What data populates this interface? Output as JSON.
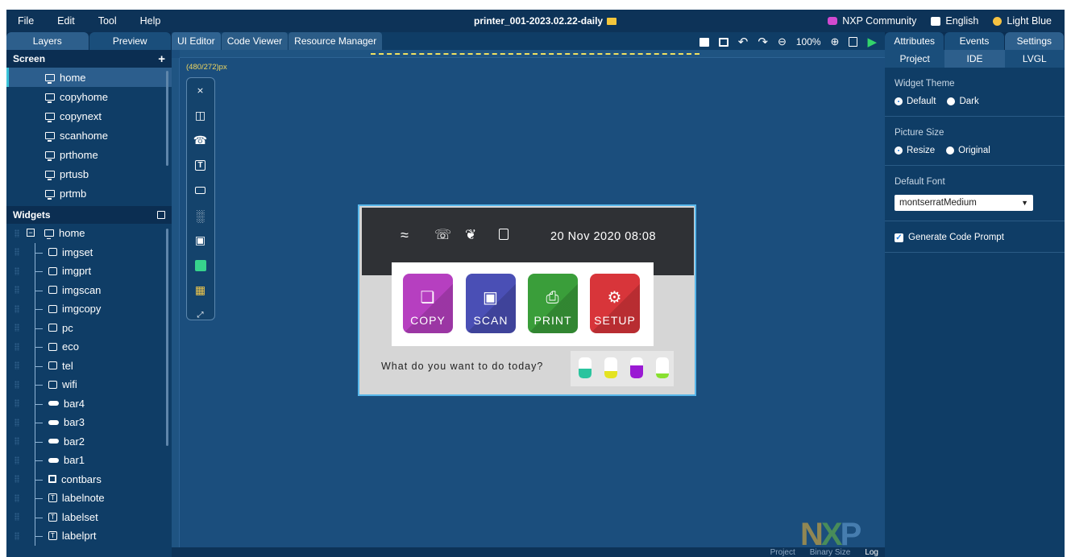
{
  "menubar": {
    "items": [
      "File",
      "Edit",
      "Tool",
      "Help"
    ],
    "title": "printer_001-2023.02.22-daily",
    "right": {
      "community": "NXP Community",
      "language": "English",
      "theme": "Light Blue"
    }
  },
  "left_panel": {
    "tabs": [
      "Layers",
      "Preview"
    ],
    "screen_header": "Screen",
    "screens": [
      "home",
      "copyhome",
      "copynext",
      "scanhome",
      "prthome",
      "prtusb",
      "prtmb"
    ],
    "widgets_header": "Widgets",
    "widgets": [
      {
        "label": "home",
        "icon": "monitor-icon"
      },
      {
        "label": "imgset",
        "icon": "image-icon"
      },
      {
        "label": "imgprt",
        "icon": "image-icon"
      },
      {
        "label": "imgscan",
        "icon": "image-icon"
      },
      {
        "label": "imgcopy",
        "icon": "image-icon"
      },
      {
        "label": "pc",
        "icon": "image-icon"
      },
      {
        "label": "eco",
        "icon": "image-icon"
      },
      {
        "label": "tel",
        "icon": "image-icon"
      },
      {
        "label": "wifi",
        "icon": "image-icon"
      },
      {
        "label": "bar4",
        "icon": "bar-icon"
      },
      {
        "label": "bar3",
        "icon": "bar-icon"
      },
      {
        "label": "bar2",
        "icon": "bar-icon"
      },
      {
        "label": "bar1",
        "icon": "bar-icon"
      },
      {
        "label": "contbars",
        "icon": "container-icon"
      },
      {
        "label": "labelnote",
        "icon": "text-icon"
      },
      {
        "label": "labelset",
        "icon": "text-icon"
      },
      {
        "label": "labelprt",
        "icon": "text-icon"
      }
    ]
  },
  "center": {
    "tabs": [
      "UI Editor",
      "Code Viewer",
      "Resource Manager"
    ],
    "zoom": "100%",
    "dimensions": "(480/272)px",
    "bottom": {
      "project": "Project",
      "binary": "Binary Size",
      "log": "Log"
    }
  },
  "device": {
    "datetime": "20 Nov 2020 08:08",
    "buttons": [
      {
        "label": "COPY",
        "color": "#b63fc0"
      },
      {
        "label": "SCAN",
        "color": "#4a4fb5"
      },
      {
        "label": "PRINT",
        "color": "#3a9e3a"
      },
      {
        "label": "SETUP",
        "color": "#d8353a"
      }
    ],
    "question": "What do you want to do today?",
    "bars": [
      {
        "fill": 0.45,
        "color": "#2bc49e"
      },
      {
        "fill": 0.35,
        "color": "#e4e321"
      },
      {
        "fill": 0.6,
        "color": "#9a1ad3"
      },
      {
        "fill": 0.25,
        "color": "#88e030"
      }
    ]
  },
  "right_panel": {
    "tabs": [
      "Attributes",
      "Events",
      "Settings"
    ],
    "subtabs": [
      "Project",
      "IDE",
      "LVGL"
    ],
    "widget_theme": {
      "label": "Widget Theme",
      "options": [
        "Default",
        "Dark"
      ],
      "selected": "Default"
    },
    "picture_size": {
      "label": "Picture Size",
      "options": [
        "Resize",
        "Original"
      ],
      "selected": "Resize"
    },
    "default_font": {
      "label": "Default Font",
      "value": "montserratMedium"
    },
    "generate_code_prompt": {
      "label": "Generate Code Prompt",
      "checked": true
    }
  },
  "logo": "NXP"
}
